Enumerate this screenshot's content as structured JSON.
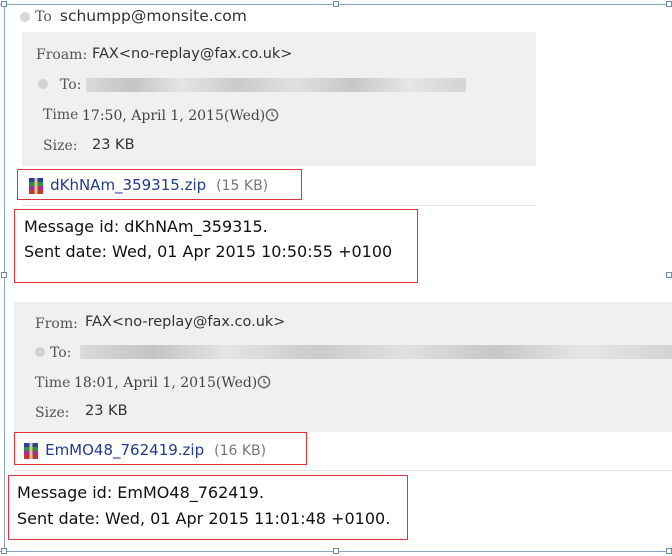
{
  "header": {
    "to_label": "To",
    "to_value": "schumpp@monsite.com"
  },
  "emails": [
    {
      "from_label": "Froam:",
      "from_value": "FAX<no-replay@fax.co.uk>",
      "to_label": "To:",
      "time_label": "Time",
      "time_value": "17:50, April 1, 2015(Wed)",
      "size_label": "Size:",
      "size_value": "23 KB",
      "attachment_name": "dKhNAm_359315.zip",
      "attachment_size": "(15 KB)",
      "message_line1": "Message id: dKhNAm_359315.",
      "message_line2": "Sent date: Wed, 01 Apr 2015 10:50:55 +0100"
    },
    {
      "from_label": "From:",
      "from_value": "FAX<no-replay@fax.co.uk>",
      "to_label": "To:",
      "time_label": "Time",
      "time_value": "18:01, April 1, 2015(Wed)",
      "size_label": "Size:",
      "size_value": "23 KB",
      "attachment_name": "EmMO48_762419.zip",
      "attachment_size": "(16 KB)",
      "message_line1": "Message id: EmMO48_762419.",
      "message_line2": "Sent date: Wed, 01 Apr 2015 11:01:48 +0100."
    }
  ],
  "icons": [
    "recipient-icon",
    "clock-icon",
    "zip-archive-icon"
  ],
  "colors": {
    "highlight_border": "#d9363e",
    "panel_bg": "#eff0f1",
    "link": "#233b8a",
    "frame": "#8aa9c9"
  }
}
